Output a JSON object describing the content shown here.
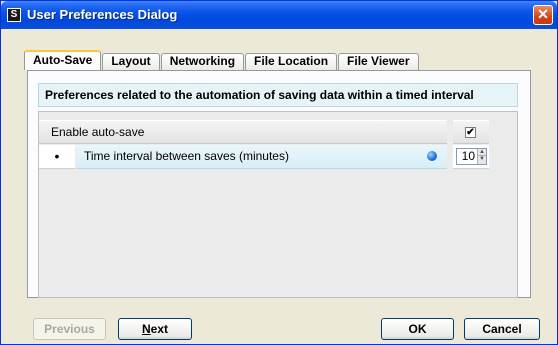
{
  "window": {
    "title": "User Preferences Dialog",
    "app_icon_glyph": "S",
    "close_glyph": "✕"
  },
  "tabs": [
    {
      "label": "Auto-Save",
      "active": true
    },
    {
      "label": "Layout",
      "active": false
    },
    {
      "label": "Networking",
      "active": false
    },
    {
      "label": "File Location",
      "active": false
    },
    {
      "label": "File Viewer",
      "active": false
    }
  ],
  "panel": {
    "description": "Preferences related to the automation of saving data within a timed interval",
    "settings": [
      {
        "label": "Enable auto-save",
        "type": "checkbox",
        "checked": true,
        "check_glyph": "✔"
      },
      {
        "bullet": "•",
        "label": "Time interval between saves (minutes)",
        "type": "spinner",
        "value": "10",
        "info_icon": "info-dot-icon"
      }
    ]
  },
  "buttons": {
    "previous": {
      "label": "Previous",
      "enabled": false
    },
    "next": {
      "label_mnemonic": "N",
      "label_rest": "ext",
      "enabled": true
    },
    "ok": {
      "label": "OK",
      "enabled": true
    },
    "cancel": {
      "label": "Cancel",
      "enabled": true
    }
  },
  "colors": {
    "titlebar": "#0a54e6",
    "tab_highlight": "#ffc83c",
    "description_bg": "#e6f4f8",
    "info_dot": "#1f6fd6"
  }
}
